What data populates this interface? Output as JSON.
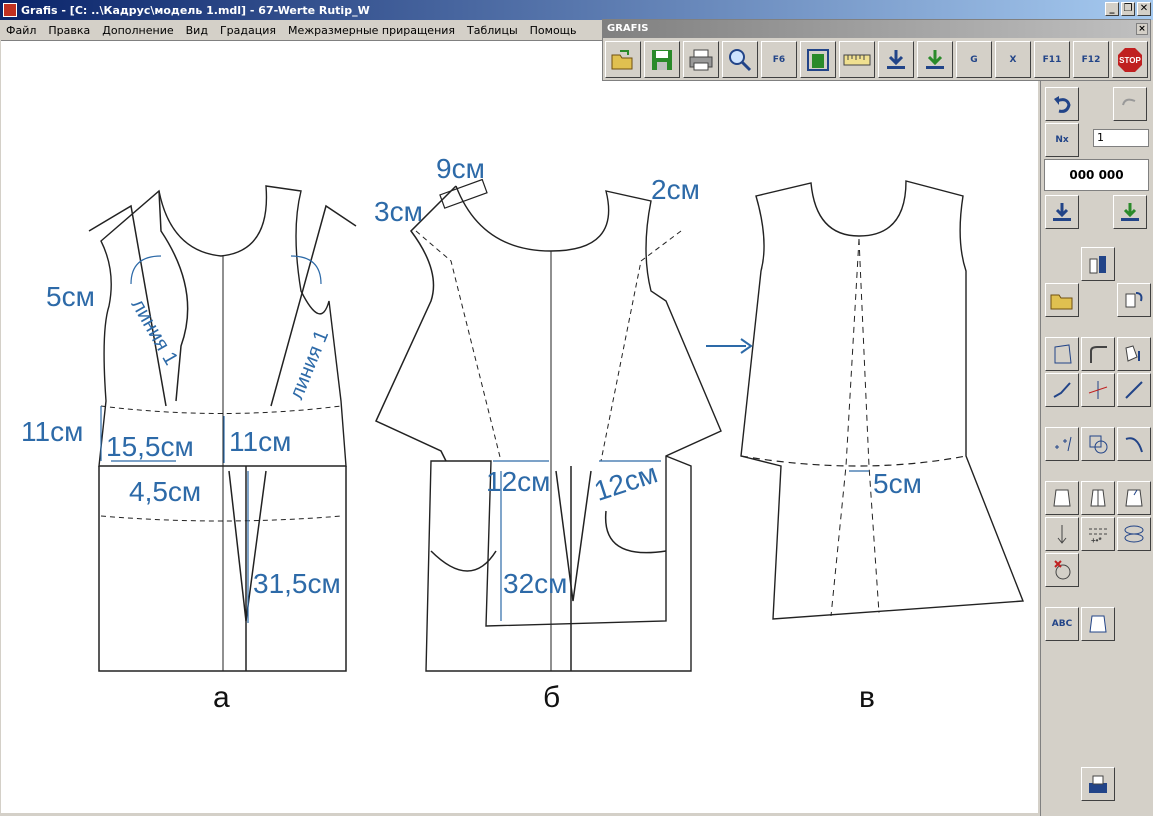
{
  "window": {
    "title": "Grafis - [C: ..\\Кадрус\\модель 1.mdl] - 67-Werte Rutip_W"
  },
  "menu": [
    "Файл",
    "Правка",
    "Дополнение",
    "Вид",
    "Градация",
    "Межразмерные приращения",
    "Таблицы",
    "Помощь"
  ],
  "toolbar": {
    "title": "GRAFIS",
    "buttons": [
      "open-icon",
      "save-icon",
      "print-icon",
      "zoom-icon",
      "F6",
      "frame-icon",
      "ruler-icon",
      "download-icon",
      "import-icon",
      "G",
      "X",
      "F11",
      "F12",
      "STOP"
    ]
  },
  "right_panel": {
    "nx_value": "1",
    "counter": "000 000"
  },
  "drawing": {
    "labels_a": {
      "m1": "5см",
      "m2": "11см",
      "m3": "15,5см",
      "m4": "11см",
      "m5": "4,5см",
      "m6": "31,5см",
      "line1": "линия 1",
      "line2": "линия 1",
      "caption": "а"
    },
    "labels_b": {
      "m1": "9см",
      "m2": "3см",
      "m3": "2см",
      "m4": "12см",
      "m5": "12см",
      "m6": "32см",
      "caption": "б"
    },
    "labels_c": {
      "m1": "5см",
      "caption": "в"
    }
  }
}
